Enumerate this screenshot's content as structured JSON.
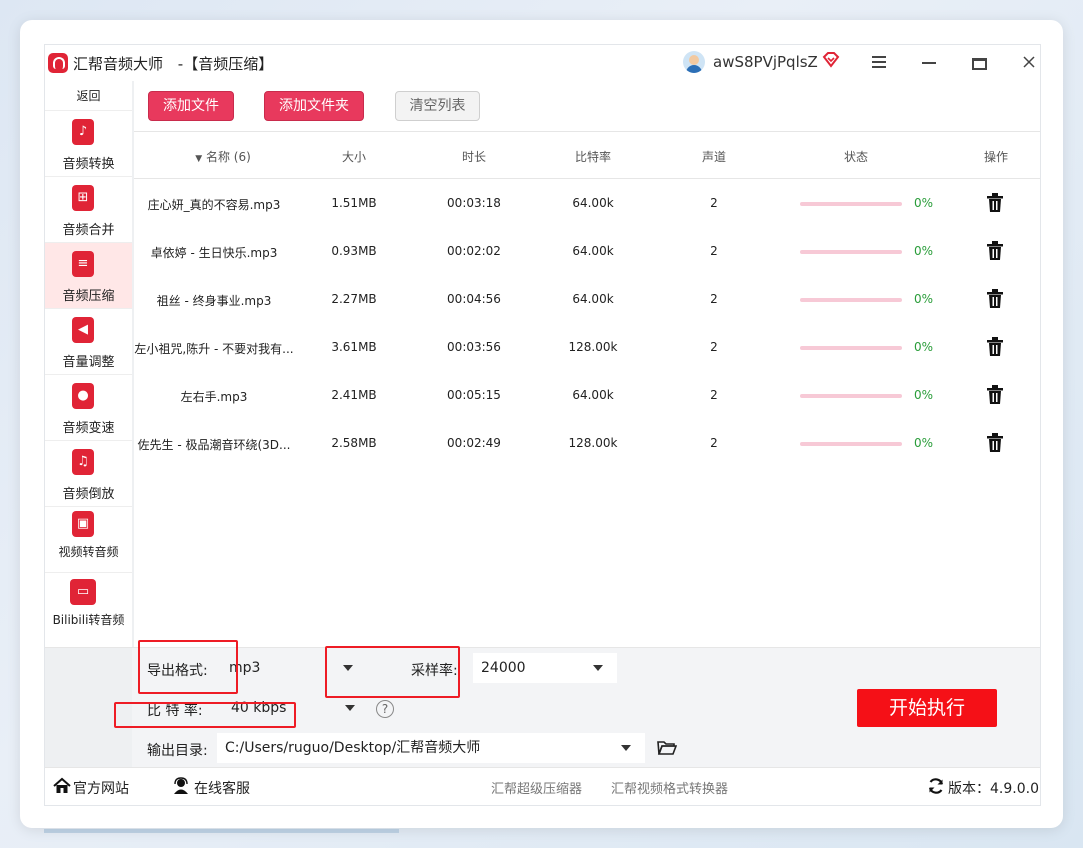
{
  "title_bar": {
    "app_name": "汇帮音频大师",
    "section": "-【音频压缩】",
    "username": "awS8PVjPqlsZ"
  },
  "sidebar": {
    "back_label": "返回",
    "items": [
      {
        "label": "音频转换",
        "icon": "audio-convert-icon",
        "active": false
      },
      {
        "label": "音频合并",
        "icon": "audio-merge-icon",
        "active": false
      },
      {
        "label": "音频压缩",
        "icon": "audio-compress-icon",
        "active": true
      },
      {
        "label": "音量调整",
        "icon": "volume-icon",
        "active": false
      },
      {
        "label": "音频变速",
        "icon": "speed-icon",
        "active": false
      },
      {
        "label": "音频倒放",
        "icon": "reverse-icon",
        "active": false
      },
      {
        "label": "视频转音频",
        "icon": "video-to-audio-icon",
        "active": false
      },
      {
        "label": "Bilibili转音频",
        "icon": "bilibili-icon",
        "active": false
      }
    ]
  },
  "toolbar": {
    "add_file": "添加文件",
    "add_folder": "添加文件夹",
    "clear_list": "清空列表"
  },
  "table": {
    "columns": [
      "名称 (6)",
      "大小",
      "时长",
      "比特率",
      "声道",
      "状态",
      "操作"
    ],
    "rows": [
      {
        "name": "庄心妍_真的不容易.mp3",
        "size": "1.51MB",
        "duration": "00:03:18",
        "bitrate": "64.00k",
        "channels": "2",
        "progress": "0%"
      },
      {
        "name": "卓依婷 - 生日快乐.mp3",
        "size": "0.93MB",
        "duration": "00:02:02",
        "bitrate": "64.00k",
        "channels": "2",
        "progress": "0%"
      },
      {
        "name": "祖丝 - 终身事业.mp3",
        "size": "2.27MB",
        "duration": "00:04:56",
        "bitrate": "64.00k",
        "channels": "2",
        "progress": "0%"
      },
      {
        "name": "左小祖咒,陈升 - 不要对我有...",
        "size": "3.61MB",
        "duration": "00:03:56",
        "bitrate": "128.00k",
        "channels": "2",
        "progress": "0%"
      },
      {
        "name": "左右手.mp3",
        "size": "2.41MB",
        "duration": "00:05:15",
        "bitrate": "64.00k",
        "channels": "2",
        "progress": "0%"
      },
      {
        "name": "佐先生 - 极品潮音环绕(3D...",
        "size": "2.58MB",
        "duration": "00:02:49",
        "bitrate": "128.00k",
        "channels": "2",
        "progress": "0%"
      }
    ]
  },
  "settings": {
    "format_label": "导出格式:",
    "format_value": "mp3",
    "sample_rate_label": "采样率:",
    "sample_rate_value": "24000",
    "bitrate_label": "比 特 率:",
    "bitrate_value": "40 kbps",
    "output_label": "输出目录:",
    "output_value": "C:/Users/ruguo/Desktop/汇帮音频大师",
    "start_label": "开始执行"
  },
  "footer": {
    "website": "官方网站",
    "support": "在线客服",
    "link1": "汇帮超级压缩器",
    "link2": "汇帮视频格式转换器",
    "version": "版本：4.9.0.0"
  },
  "background_text": "\"!!!!!\"!#!!!!!!!!!!!!!!!!!!!!!!!!!!!!!!!!!!!!!!!!!!!!!!!!!!!!!!!!!!!!!!!!!!!!!!!!!!!!!!!!!!!!!!!!!!!!!!!!!!!!!!!!!!!!!!!!!!!!!!!!!!!",
  "colors": {
    "brand_red": "#e02436",
    "button_red": "#e8395d",
    "start_red": "#f51017",
    "progress_green": "#2a9d3a"
  }
}
